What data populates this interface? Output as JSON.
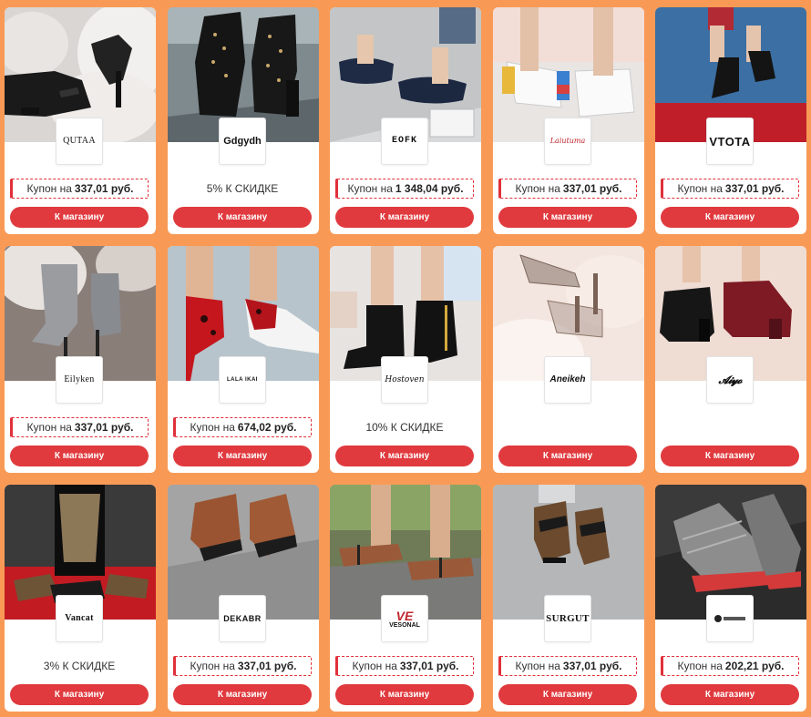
{
  "cards": [
    {
      "brand": "QUTAA",
      "offer_type": "coupon",
      "offer_prefix": "Купон на",
      "offer_amount": "337,01 руб.",
      "button": "К магазину",
      "image": "black-strappy-heels-on-fur"
    },
    {
      "brand": "Gdgydh",
      "offer_type": "discount",
      "offer_text": "5% К СКИДКЕ",
      "button": "К магазину",
      "image": "studded-gladiator-heels"
    },
    {
      "brand": "EOFK",
      "offer_type": "coupon",
      "offer_prefix": "Купон на",
      "offer_amount": "1 348,04 руб.",
      "button": "К магазину",
      "image": "navy-ballet-flats"
    },
    {
      "brand": "Laiutuma",
      "offer_type": "coupon",
      "offer_prefix": "Купон на",
      "offer_amount": "337,01 руб.",
      "button": "К магазину",
      "image": "white-jeweled-mules"
    },
    {
      "brand": "VTOTA",
      "offer_type": "coupon",
      "offer_prefix": "Купон на",
      "offer_amount": "337,01 руб.",
      "button": "К магазину",
      "image": "black-ankle-boots-red-floor"
    },
    {
      "brand": "Eilyken",
      "offer_type": "coupon",
      "offer_prefix": "Купон на",
      "offer_amount": "337,01 руб.",
      "button": "К магазину",
      "image": "glitter-stiletto-boots"
    },
    {
      "brand": "LALA IKAI",
      "offer_type": "coupon",
      "offer_prefix": "Купон на",
      "offer_amount": "674,02 руб.",
      "button": "К магазину",
      "image": "red-leopard-pumps"
    },
    {
      "brand": "Hostoven",
      "offer_type": "discount",
      "offer_text": "10% К СКИДКЕ",
      "button": "К магазину",
      "image": "black-suede-ankle-boots"
    },
    {
      "brand": "Aneikeh",
      "offer_type": "none",
      "button": "К магазину",
      "image": "clear-perspex-heels"
    },
    {
      "brand": "Aiyoyo",
      "offer_type": "none",
      "button": "К магазину",
      "image": "black-and-burgundy-boots"
    },
    {
      "brand": "Vancat",
      "offer_type": "discount",
      "offer_text": "3% К СКИДКЕ",
      "button": "К магазину",
      "image": "mens-leather-loafers"
    },
    {
      "brand": "DEKABR",
      "offer_type": "coupon",
      "offer_prefix": "Купон на",
      "offer_amount": "337,01 руб.",
      "button": "К магазину",
      "image": "brown-leather-sandals"
    },
    {
      "brand": "VESONAL",
      "offer_type": "coupon",
      "offer_prefix": "Купон на",
      "offer_amount": "337,01 руб.",
      "button": "К магазину",
      "image": "sandals-on-rocks"
    },
    {
      "brand": "SURGUT",
      "offer_type": "coupon",
      "offer_prefix": "Купон на",
      "offer_amount": "337,01 руб.",
      "button": "К магазину",
      "image": "sport-sandals"
    },
    {
      "brand": "",
      "offer_type": "coupon",
      "offer_prefix": "Купон на",
      "offer_amount": "202,21 руб.",
      "button": "К магазину",
      "image": "grey-knit-sneakers"
    }
  ],
  "colors": {
    "background": "#f89a56",
    "accent": "#e03a3e",
    "card": "#ffffff"
  }
}
